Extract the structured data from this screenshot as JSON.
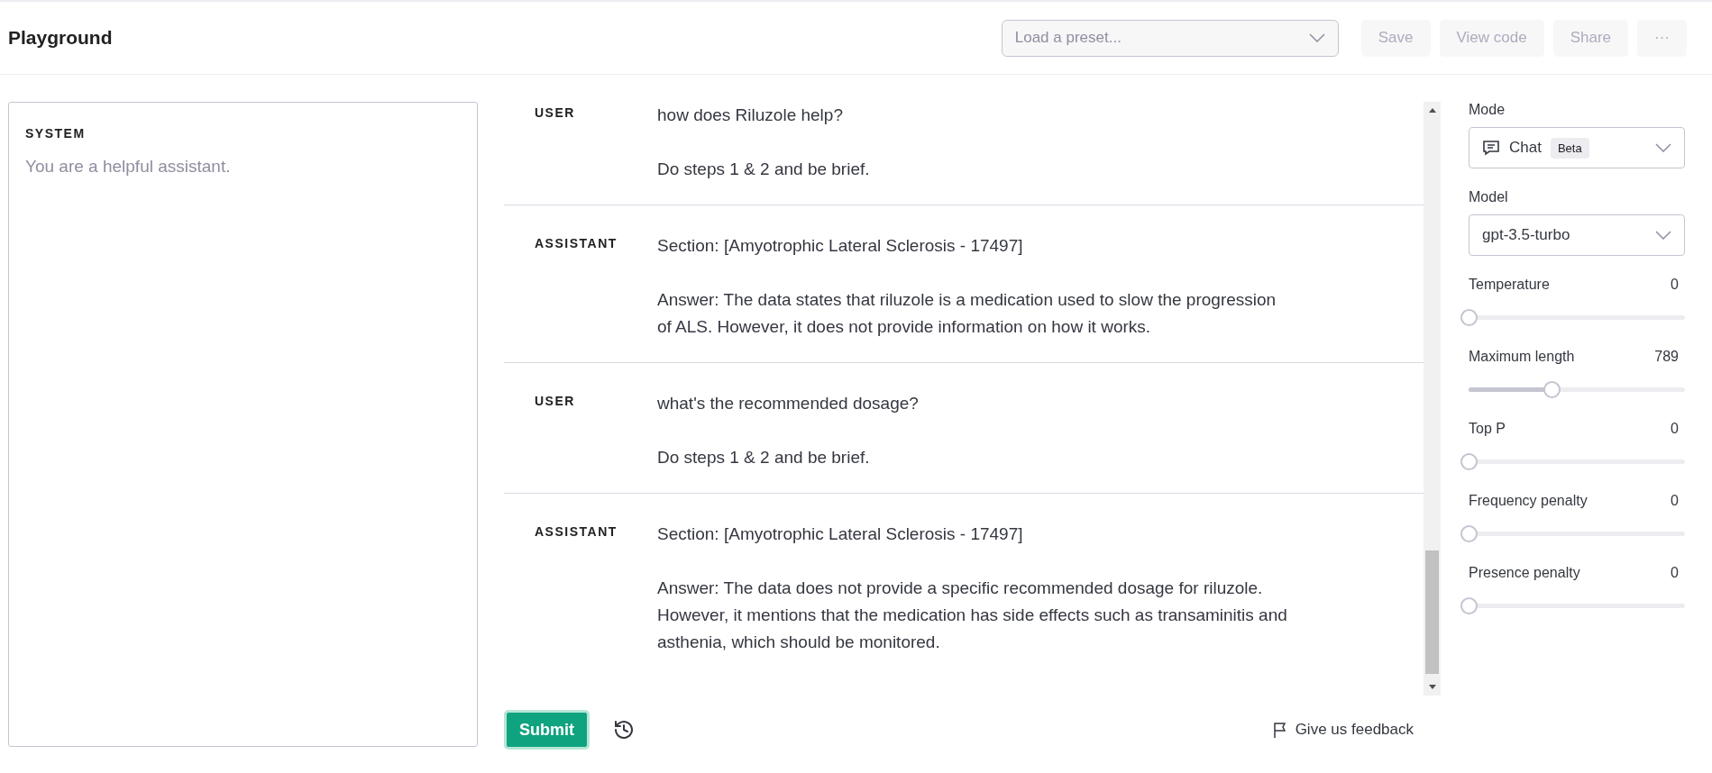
{
  "header": {
    "title": "Playground",
    "preset": {
      "placeholder": "Load a preset..."
    },
    "buttons": [
      "Save",
      "View code",
      "Share"
    ],
    "more": "···"
  },
  "system": {
    "label": "SYSTEM",
    "placeholder": "You are a helpful assistant."
  },
  "messages": [
    {
      "role": "USER",
      "paragraphs": [
        "how does Riluzole help?",
        "Do steps 1 & 2 and be brief."
      ]
    },
    {
      "role": "ASSISTANT",
      "paragraphs": [
        "Section: [Amyotrophic Lateral Sclerosis - 17497]",
        "Answer: The data states that riluzole is a medication used to slow the progression of ALS. However, it does not provide information on how it works."
      ]
    },
    {
      "role": "USER",
      "paragraphs": [
        "what's the recommended dosage?",
        "Do steps 1 & 2 and be brief."
      ]
    },
    {
      "role": "ASSISTANT",
      "paragraphs": [
        "Section: [Amyotrophic Lateral Sclerosis - 17497]",
        "Answer: The data does not provide a specific recommended dosage for riluzole. However, it mentions that the medication has side effects such as transaminitis and asthenia, which should be monitored."
      ]
    }
  ],
  "submit": "Submit",
  "feedback": "Give us feedback",
  "settings": {
    "mode": {
      "label": "Mode",
      "value": "Chat",
      "badge": "Beta"
    },
    "model": {
      "label": "Model",
      "value": "gpt-3.5-turbo"
    },
    "sliders": [
      {
        "label": "Temperature",
        "reading": "0",
        "level": 0
      },
      {
        "label": "Maximum length",
        "reading": "789",
        "level": 0.385
      },
      {
        "label": "Top P",
        "reading": "0",
        "level": 0
      },
      {
        "label": "Frequency penalty",
        "reading": "0",
        "level": 0
      },
      {
        "label": "Presence penalty",
        "reading": "0",
        "level": 0
      }
    ]
  }
}
